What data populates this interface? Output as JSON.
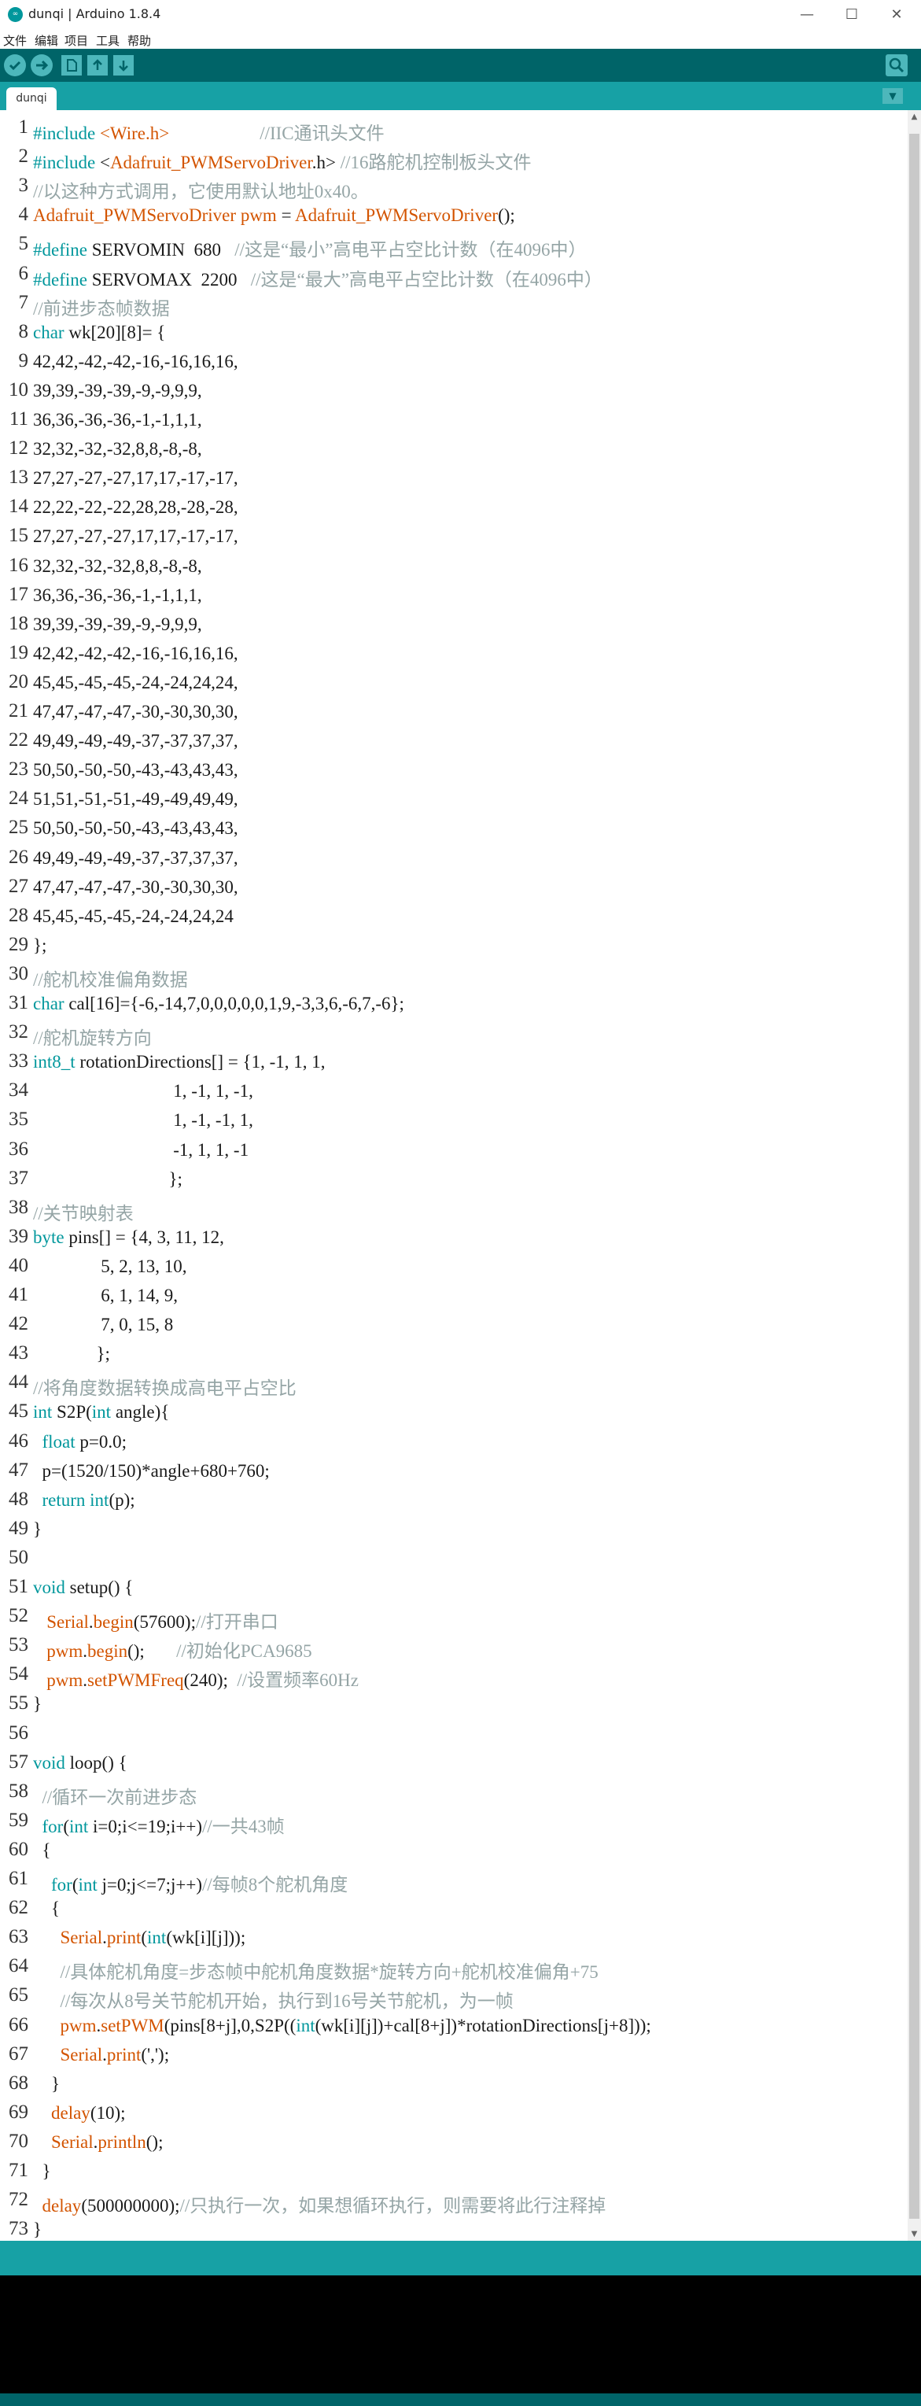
{
  "window": {
    "title": "dunqi | Arduino 1.8.4",
    "icon_text": "∞",
    "controls": [
      "—",
      "☐",
      "✕"
    ]
  },
  "menu": [
    "文件",
    "编辑",
    "项目",
    "工具",
    "帮助"
  ],
  "toolbar": {
    "icons": [
      "verify-icon",
      "upload-icon",
      "new-icon",
      "open-icon",
      "save-icon",
      "serial-monitor-icon"
    ]
  },
  "tab": {
    "label": "dunqi"
  },
  "colors": {
    "toolbar": "#006468",
    "tabbar": "#17a1a5",
    "keyword": "#00979c",
    "function": "#d35400",
    "comment": "#95a5a6"
  },
  "code": [
    "#include <Wire.h>                    //IIC通讯头文件",
    "#include <Adafruit_PWMServoDriver.h> //16路舵机控制板头文件",
    "//以这种方式调用，它使用默认地址0x40。",
    "Adafruit_PWMServoDriver pwm = Adafruit_PWMServoDriver();",
    "#define SERVOMIN  680   //这是“最小”高电平占空比计数（在4096中）",
    "#define SERVOMAX  2200   //这是“最大”高电平占空比计数（在4096中）",
    "//前进步态帧数据",
    "char wk[20][8]= {",
    "42,42,-42,-42,-16,-16,16,16,",
    "39,39,-39,-39,-9,-9,9,9,",
    "36,36,-36,-36,-1,-1,1,1,",
    "32,32,-32,-32,8,8,-8,-8,",
    "27,27,-27,-27,17,17,-17,-17,",
    "22,22,-22,-22,28,28,-28,-28,",
    "27,27,-27,-27,17,17,-17,-17,",
    "32,32,-32,-32,8,8,-8,-8,",
    "36,36,-36,-36,-1,-1,1,1,",
    "39,39,-39,-39,-9,-9,9,9,",
    "42,42,-42,-42,-16,-16,16,16,",
    "45,45,-45,-45,-24,-24,24,24,",
    "47,47,-47,-47,-30,-30,30,30,",
    "49,49,-49,-49,-37,-37,37,37,",
    "50,50,-50,-50,-43,-43,43,43,",
    "51,51,-51,-51,-49,-49,49,49,",
    "50,50,-50,-50,-43,-43,43,43,",
    "49,49,-49,-49,-37,-37,37,37,",
    "47,47,-47,-47,-30,-30,30,30,",
    "45,45,-45,-45,-24,-24,24,24",
    "};",
    "//舵机校准偏角数据",
    "char cal[16]={-6,-14,7,0,0,0,0,0,1,9,-3,3,6,-6,7,-6};",
    "//舵机旋转方向",
    "int8_t rotationDirections[] = {1, -1, 1, 1,",
    "                               1, -1, 1, -1,",
    "                               1, -1, -1, 1,",
    "                               -1, 1, 1, -1",
    "                              };",
    "//关节映射表",
    "byte pins[] = {4, 3, 11, 12,",
    "               5, 2, 13, 10,",
    "               6, 1, 14, 9,",
    "               7, 0, 15, 8",
    "              };",
    "//将角度数据转换成高电平占空比",
    "int S2P(int angle){",
    "  float p=0.0;",
    "  p=(1520/150)*angle+680+760;",
    "  return int(p);",
    "}",
    "",
    "void setup() {",
    "   Serial.begin(57600);//打开串口",
    "   pwm.begin();       //初始化PCA9685",
    "   pwm.setPWMFreq(240);  //设置频率60Hz",
    "}",
    "",
    "void loop() {",
    "  //循环一次前进步态",
    "  for(int i=0;i<=19;i++)//一共43帧",
    "  {",
    "    for(int j=0;j<=7;j++)//每帧8个舵机角度",
    "    {",
    "      Serial.print(int(wk[i][j]));",
    "      //具体舵机角度=步态帧中舵机角度数据*旋转方向+舵机校准偏角+75",
    "      //每次从8号关节舵机开始，执行到16号关节舵机，为一帧",
    "      pwm.setPWM(pins[8+j],0,S2P((int(wk[i][j])+cal[8+j])*rotationDirections[j+8]));",
    "      Serial.print(',');",
    "    }",
    "    delay(10);",
    "    Serial.println();",
    "  }",
    "  delay(500000000);//只执行一次，如果想循环执行，则需要将此行注释掉",
    "}"
  ]
}
